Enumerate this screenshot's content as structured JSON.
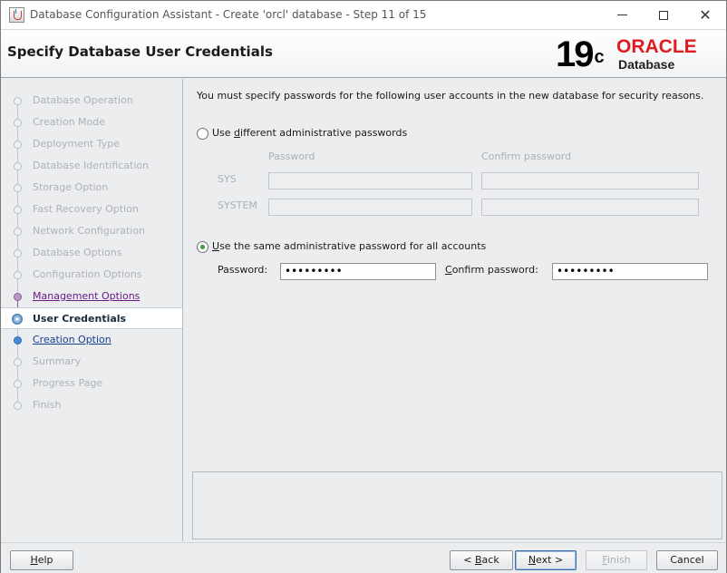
{
  "window": {
    "title": "Database Configuration Assistant - Create 'orcl' database - Step 11 of 15",
    "minimize_glyph": "",
    "maximize_glyph": "",
    "close_glyph": "✕"
  },
  "header": {
    "title": "Specify Database User Credentials",
    "logo": {
      "version": "19",
      "version_sup": "c",
      "brand": "ORACLE",
      "product": "Database",
      "brand_color": "#e11b22"
    }
  },
  "sidebar": {
    "steps": [
      {
        "label": "Database Operation",
        "state": "disabled"
      },
      {
        "label": "Creation Mode",
        "state": "disabled"
      },
      {
        "label": "Deployment Type",
        "state": "disabled"
      },
      {
        "label": "Database Identification",
        "state": "disabled"
      },
      {
        "label": "Storage Option",
        "state": "disabled"
      },
      {
        "label": "Fast Recovery Option",
        "state": "disabled"
      },
      {
        "label": "Network Configuration",
        "state": "disabled"
      },
      {
        "label": "Database Options",
        "state": "disabled"
      },
      {
        "label": "Configuration Options",
        "state": "disabled"
      },
      {
        "label": "Management Options",
        "state": "visited"
      },
      {
        "label": "User Credentials",
        "state": "current"
      },
      {
        "label": "Creation Option",
        "state": "next"
      },
      {
        "label": "Summary",
        "state": "disabled"
      },
      {
        "label": "Progress Page",
        "state": "disabled"
      },
      {
        "label": "Finish",
        "state": "disabled"
      }
    ]
  },
  "main": {
    "intro": "You must specify passwords for the following user accounts in the new database for security reasons.",
    "option_different": {
      "label_pre": "Use ",
      "label_mnemonic": "d",
      "label_post": "ifferent administrative passwords",
      "selected": false,
      "column_password": "Password",
      "column_confirm": "Confirm password",
      "rows": [
        {
          "user": "SYS"
        },
        {
          "user": "SYSTEM"
        }
      ]
    },
    "option_same": {
      "label_pre": "",
      "label_mnemonic": "U",
      "label_post": "se the same administrative password for all accounts",
      "selected": true,
      "password_label": "Password:",
      "password_value": "•••••••••",
      "confirm_label_mnemonic": "C",
      "confirm_label_rest": "onfirm password:",
      "confirm_value": "•••••••••"
    },
    "messages": ""
  },
  "footer": {
    "help": {
      "mnemonic": "H",
      "rest": "elp",
      "enabled": true
    },
    "back": {
      "pre": "< ",
      "mnemonic": "B",
      "rest": "ack",
      "enabled": true
    },
    "next": {
      "mnemonic": "N",
      "rest": "ext >",
      "enabled": true
    },
    "finish": {
      "mnemonic": "F",
      "rest": "inish",
      "enabled": false
    },
    "cancel": {
      "label": "Cancel",
      "enabled": true
    }
  }
}
